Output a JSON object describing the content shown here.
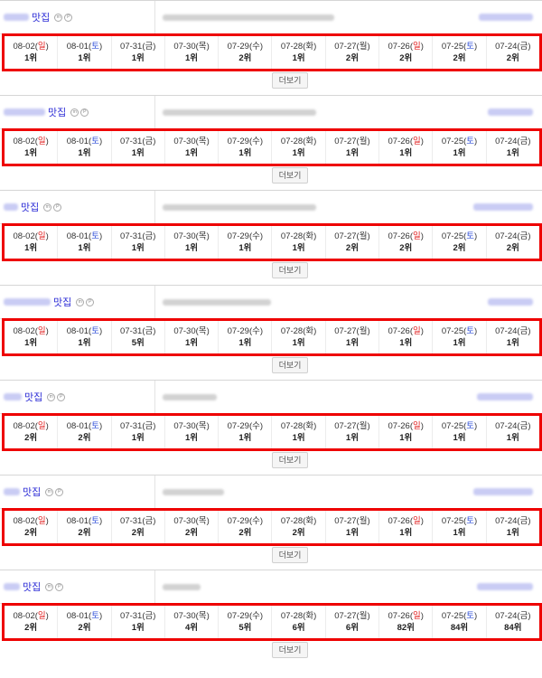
{
  "more_label": "더보기",
  "colors": {
    "highlight": "#ee0000",
    "sunday": "#e02020",
    "saturday": "#2f4fd8"
  },
  "dates": [
    {
      "date": "08-02",
      "dow": "일",
      "type": "sun"
    },
    {
      "date": "08-01",
      "dow": "토",
      "type": "sat"
    },
    {
      "date": "07-31",
      "dow": "금",
      "type": "wk"
    },
    {
      "date": "07-30",
      "dow": "목",
      "type": "wk"
    },
    {
      "date": "07-29",
      "dow": "수",
      "type": "wk"
    },
    {
      "date": "07-28",
      "dow": "화",
      "type": "wk"
    },
    {
      "date": "07-27",
      "dow": "월",
      "type": "wk"
    },
    {
      "date": "07-26",
      "dow": "일",
      "type": "sun"
    },
    {
      "date": "07-25",
      "dow": "토",
      "type": "sat"
    },
    {
      "date": "07-24",
      "dow": "금",
      "type": "wk"
    }
  ],
  "rows": [
    {
      "keyword_suffix": "맛집",
      "ranks": [
        "1위",
        "1위",
        "1위",
        "1위",
        "2위",
        "1위",
        "2위",
        "2위",
        "2위",
        "2위"
      ]
    },
    {
      "keyword_suffix": "맛집",
      "ranks": [
        "1위",
        "1위",
        "1위",
        "1위",
        "1위",
        "1위",
        "1위",
        "1위",
        "1위",
        "1위"
      ]
    },
    {
      "keyword_suffix": "맛집",
      "ranks": [
        "1위",
        "1위",
        "1위",
        "1위",
        "1위",
        "1위",
        "2위",
        "2위",
        "2위",
        "2위"
      ]
    },
    {
      "keyword_suffix": "맛집",
      "ranks": [
        "1위",
        "1위",
        "5위",
        "1위",
        "1위",
        "1위",
        "1위",
        "1위",
        "1위",
        "1위"
      ]
    },
    {
      "keyword_suffix": "맛집",
      "ranks": [
        "2위",
        "2위",
        "1위",
        "1위",
        "1위",
        "1위",
        "1위",
        "1위",
        "1위",
        "1위"
      ]
    },
    {
      "keyword_suffix": "맛집",
      "ranks": [
        "2위",
        "2위",
        "2위",
        "2위",
        "2위",
        "2위",
        "1위",
        "1위",
        "1위",
        "1위"
      ]
    },
    {
      "keyword_suffix": "맛집",
      "ranks": [
        "2위",
        "2위",
        "1위",
        "4위",
        "5위",
        "6위",
        "6위",
        "82위",
        "84위",
        "84위"
      ]
    }
  ]
}
